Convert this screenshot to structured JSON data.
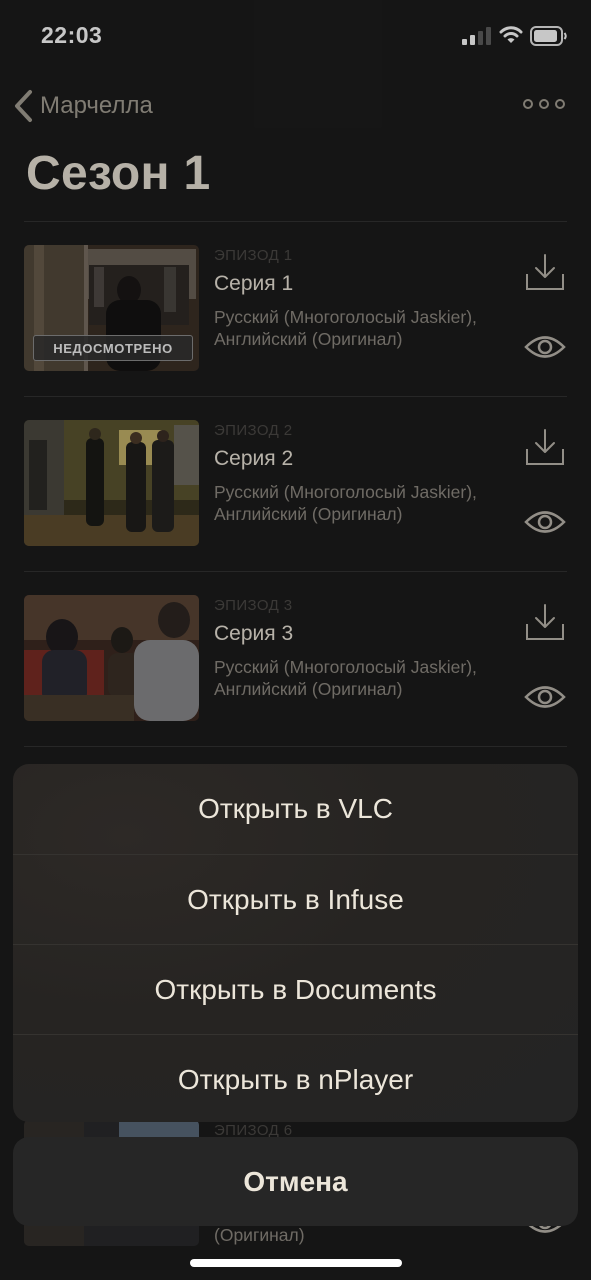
{
  "status_bar": {
    "time": "22:03"
  },
  "nav": {
    "back_label": "Марчелла"
  },
  "title": "Сезон 1",
  "badge": {
    "unwatched": "НЕДОСМОТРЕНО"
  },
  "episodes": [
    {
      "label": "ЭПИЗОД 1",
      "title": "Серия 1",
      "audio": "Русский (Многоголосый Jaskier), Английский (Оригинал)"
    },
    {
      "label": "ЭПИЗОД 2",
      "title": "Серия 2",
      "audio": "Русский (Многоголосый Jaskier), Английский (Оригинал)"
    },
    {
      "label": "ЭПИЗОД 3",
      "title": "Серия 3",
      "audio": "Русский (Многоголосый Jaskier), Английский (Оригинал)"
    },
    {
      "label": "ЭПИЗОД 6",
      "title": "",
      "audio": "(Оригинал)"
    }
  ],
  "action_sheet": {
    "options": [
      "Открыть в VLC",
      "Открыть в Infuse",
      "Открыть в Documents",
      "Открыть в nPlayer"
    ],
    "cancel": "Отмена"
  },
  "colors": {
    "background": "#1c1c1c",
    "text": "#ece6da",
    "muted": "#8f8a82",
    "icon": "#bcb7ad"
  }
}
